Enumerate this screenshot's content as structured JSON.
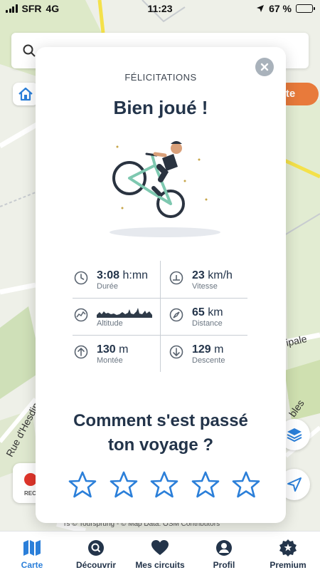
{
  "status_bar": {
    "carrier": "SFR",
    "network": "4G",
    "time": "11:23",
    "battery": "67 %",
    "battery_level": 0.67
  },
  "map": {
    "top_right_button": "rte",
    "road_labels": [
      "Rue d'Hesdin",
      "ipale",
      "bles"
    ],
    "record_label": "REC",
    "attribution": "rs © Toursprung - © Map Data: OSM Contributors"
  },
  "modal": {
    "kicker": "FÉLICITATIONS",
    "title": "Bien joué !",
    "stats": [
      {
        "icon": "clock-icon",
        "value": "3:08",
        "unit": "h:mn",
        "label": "Durée"
      },
      {
        "icon": "speedometer-icon",
        "value": "23",
        "unit": "km/h",
        "label": "Vitesse"
      },
      {
        "icon": "elevation-icon",
        "value": "",
        "unit": "",
        "label": "Altitude"
      },
      {
        "icon": "compass-icon",
        "value": "65",
        "unit": "km",
        "label": "Distance"
      },
      {
        "icon": "arrow-up-icon",
        "value": "130",
        "unit": "m",
        "label": "Montée"
      },
      {
        "icon": "arrow-down-icon",
        "value": "129",
        "unit": "m",
        "label": "Descente"
      }
    ],
    "question_line1": "Comment s'est passé",
    "question_line2": "ton voyage ?",
    "stars_count": 5,
    "rating": 0
  },
  "tabs": [
    {
      "label": "Carte",
      "icon": "map-icon",
      "active": true
    },
    {
      "label": "Découvrir",
      "icon": "search-icon",
      "active": false
    },
    {
      "label": "Mes circuits",
      "icon": "heart-icon",
      "active": false
    },
    {
      "label": "Profil",
      "icon": "profile-icon",
      "active": false
    },
    {
      "label": "Premium",
      "icon": "premium-badge-icon",
      "active": false
    }
  ],
  "colors": {
    "accent": "#2b7fd9",
    "title": "#23344a",
    "orange": "#e87a3b",
    "record": "#e0352b"
  }
}
